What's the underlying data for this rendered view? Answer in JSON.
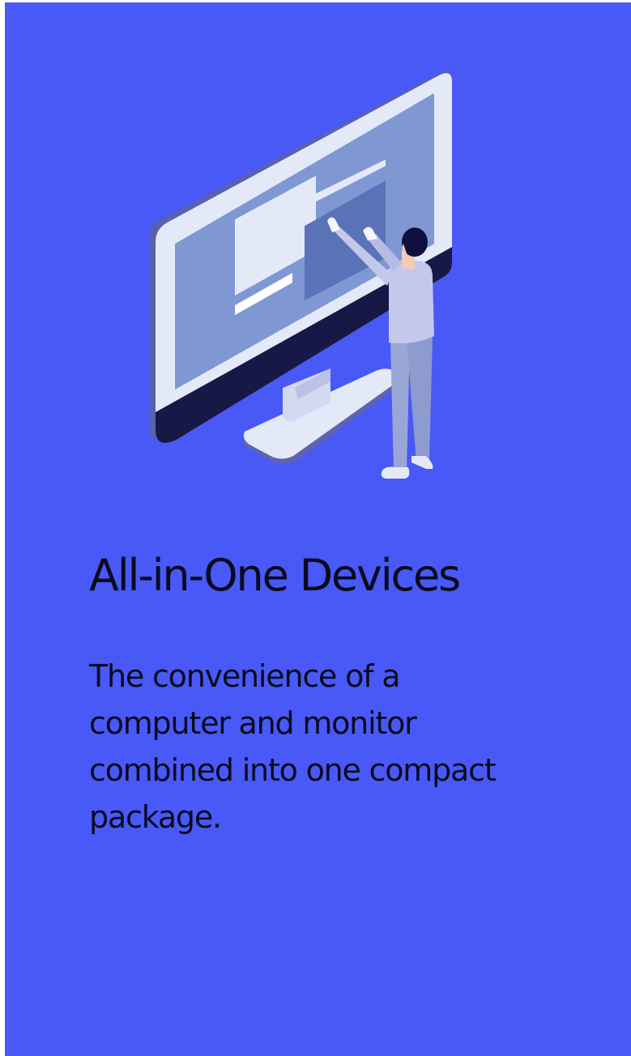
{
  "card": {
    "title": "All-in-One Devices",
    "description": "The convenience of a computer and monitor combined into one compact package."
  },
  "illustration": {
    "icon": "all-in-one-computer-person-icon"
  },
  "colors": {
    "background": "#4859f7",
    "text": "#0a0a1e",
    "monitor_frame": "#e3e9f7",
    "monitor_screen": "#7f98d4",
    "monitor_dark": "#181847",
    "person_shirt": "#c3c9ea",
    "person_pants": "#9aa7d6"
  }
}
